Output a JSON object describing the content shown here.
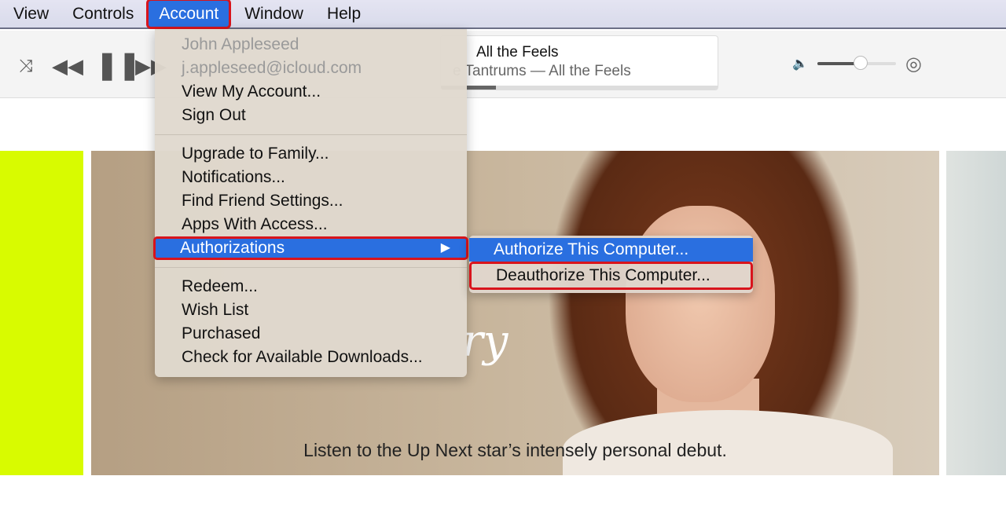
{
  "menubar": {
    "items": [
      "View",
      "Controls",
      "Account",
      "Window",
      "Help"
    ],
    "active": "Account"
  },
  "player": {
    "title": "All the Feels",
    "subtitle": "e Tantrums — All the Feels",
    "progress": 0.2,
    "volume": 0.55
  },
  "account_menu": {
    "user_name": "John Appleseed",
    "user_email": "j.appleseed@icloud.com",
    "group1": [
      "View My Account...",
      "Sign Out"
    ],
    "group2": [
      "Upgrade to Family...",
      "Notifications...",
      "Find Friend Settings...",
      "Apps With Access...",
      "Authorizations"
    ],
    "group3": [
      "Redeem...",
      "Wish List",
      "Purchased",
      "Check for Available Downloads..."
    ],
    "submenu_arrow": "▶"
  },
  "submenu": {
    "items": [
      "Authorize This Computer...",
      "Deauthorize This Computer..."
    ]
  },
  "banner": {
    "logo_fragment": "ry",
    "caption": "Listen to the Up Next star’s intensely personal debut."
  },
  "colors": {
    "accent": "#2a6fe0",
    "highlight_outline": "#d8141c",
    "lime": "#d8fb00"
  }
}
